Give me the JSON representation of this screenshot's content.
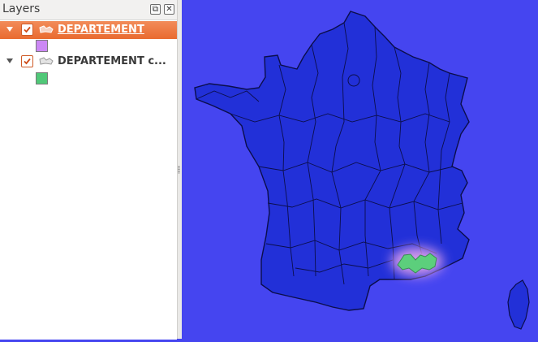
{
  "panel": {
    "title": "Layers"
  },
  "layers": [
    {
      "name": "DEPARTEMENT",
      "checked": true,
      "selected": true,
      "symbol_color": "#cc88f5"
    },
    {
      "name": "DEPARTEMENT c...",
      "checked": true,
      "selected": false,
      "symbol_color": "#50c878"
    }
  ],
  "map": {
    "background_color": "#4545f0",
    "fill_color": "#2230d8",
    "highlight_fill_color": "#5ccf7c",
    "glow_color": "#d99bea"
  },
  "icons": [
    "float-icon",
    "close-icon",
    "checkbox-checked-icon",
    "polygon-layer-icon",
    "expand-arrow-icon"
  ]
}
